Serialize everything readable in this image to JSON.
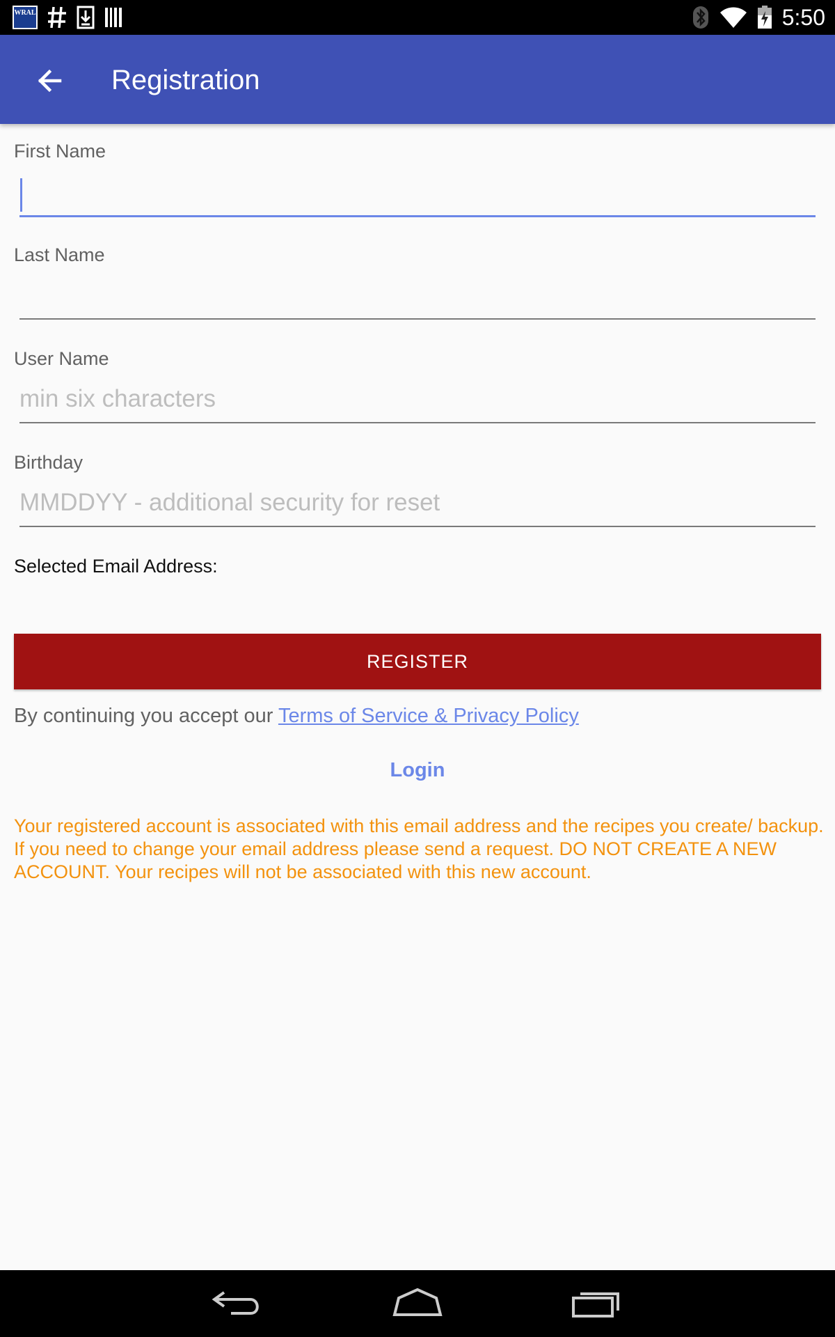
{
  "status_bar": {
    "time": "5:50",
    "left_icons": [
      "wral-weather-icon",
      "hash-icon",
      "download-icon",
      "barcode-icon"
    ],
    "wral_text": "WRAL",
    "right_icons": [
      "bluetooth-icon",
      "wifi-icon",
      "battery-charging-icon"
    ]
  },
  "app_bar": {
    "title": "Registration",
    "color": "#3f51b5"
  },
  "form": {
    "first_name": {
      "label": "First Name",
      "value": "",
      "placeholder": ""
    },
    "last_name": {
      "label": "Last Name",
      "value": "",
      "placeholder": ""
    },
    "user_name": {
      "label": "User Name",
      "value": "",
      "placeholder": "min six characters"
    },
    "birthday": {
      "label": "Birthday",
      "value": "",
      "placeholder": "MMDDYY - additional security for reset"
    },
    "selected_email_label": "Selected Email Address:"
  },
  "register_button": {
    "label": "REGISTER",
    "color": "#a01212"
  },
  "terms": {
    "prefix": "By continuing you accept our ",
    "link_text": "Terms of Service & Privacy Policy"
  },
  "login_link": "Login",
  "notice": "Your registered account is associated with this email address and the recipes you create/ backup. If you need to change your email address please send a request. DO NOT CREATE A NEW ACCOUNT. Your recipes will not be associated with this new account.",
  "colors": {
    "accent": "#6b87e8",
    "notice": "#f3920e"
  },
  "nav_bar": {
    "icons": [
      "back-nav-icon",
      "home-nav-icon",
      "recents-nav-icon"
    ]
  }
}
